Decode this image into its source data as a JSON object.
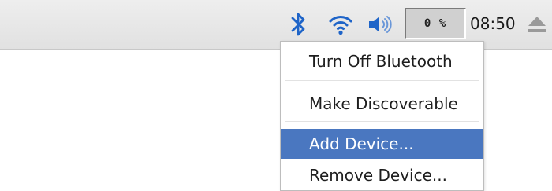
{
  "taskbar": {
    "icons": {
      "bluetooth": "bluetooth-icon",
      "wifi": "wifi-icon",
      "volume": "volume-icon",
      "eject": "eject-icon"
    },
    "cpu_usage": "0 %",
    "clock": "08:50"
  },
  "bluetooth_menu": {
    "items": [
      {
        "label": "Turn Off Bluetooth",
        "highlighted": false
      },
      {
        "label": "Make Discoverable",
        "highlighted": false
      },
      {
        "label": "Add Device...",
        "highlighted": true
      },
      {
        "label": "Remove Device...",
        "highlighted": false
      }
    ]
  },
  "colors": {
    "accent_blue": "#1e64c8",
    "highlight": "#4a77c0",
    "taskbar_bg": "#e6e6e6"
  }
}
